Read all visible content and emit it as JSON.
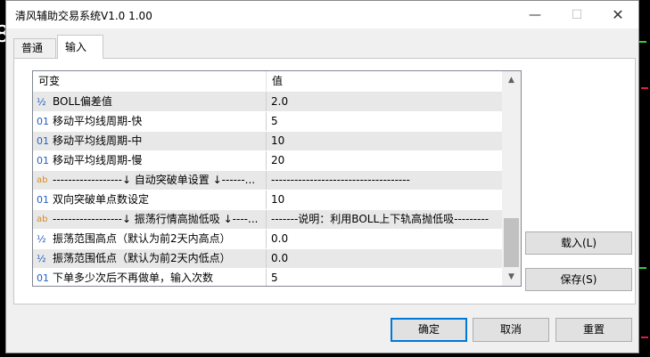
{
  "backdrop": {
    "left_glyph": "8"
  },
  "window": {
    "title": "清风辅助交易系统V1.0 1.00",
    "controls": {
      "minimize": "—",
      "maximize": "☐",
      "close": "✕"
    }
  },
  "tabs": [
    {
      "label": "普通",
      "active": false
    },
    {
      "label": "输入",
      "active": true
    }
  ],
  "grid": {
    "headers": {
      "name": "可变",
      "value": "值"
    },
    "rows": [
      {
        "type": "½",
        "name": "BOLL偏差值",
        "value": "2.0"
      },
      {
        "type": "01",
        "name": "移动平均线周期-快",
        "value": "5"
      },
      {
        "type": "01",
        "name": "移动平均线周期-中",
        "value": "10"
      },
      {
        "type": "01",
        "name": "移动平均线周期-慢",
        "value": "20"
      },
      {
        "type": "ab",
        "name": "------------------↓ 自动突破单设置 ↓------...",
        "value": "------------------------------------"
      },
      {
        "type": "01",
        "name": "双向突破单点数设定",
        "value": "10"
      },
      {
        "type": "ab",
        "name": "------------------↓ 振荡行情高抛低吸 ↓----...",
        "value": "-------说明：利用BOLL上下轨高抛低吸---------"
      },
      {
        "type": "½",
        "name": "振荡范围高点（默认为前2天内高点）",
        "value": "0.0"
      },
      {
        "type": "½",
        "name": "振荡范围低点（默认为前2天内低点）",
        "value": "0.0"
      },
      {
        "type": "01",
        "name": "下单多少次后不再做单，输入次数",
        "value": "5"
      }
    ],
    "scrollbar": {
      "up": "▲",
      "down": "▼"
    }
  },
  "buttons": {
    "load": "载入(L)",
    "save": "保存(S)",
    "ok": "确定",
    "cancel": "取消",
    "reset": "重置"
  }
}
